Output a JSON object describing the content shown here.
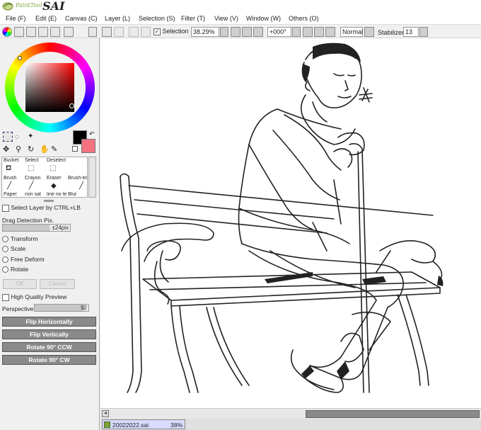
{
  "app": {
    "logo_small": "PaintTool",
    "logo_big": "SAI"
  },
  "menu": {
    "items": [
      {
        "label": "File (F)"
      },
      {
        "label": "Edit (E)"
      },
      {
        "label": "Canvas (C)"
      },
      {
        "label": "Layer (L)"
      },
      {
        "label": "Selection (S)"
      },
      {
        "label": "Filter (T)"
      },
      {
        "label": "View (V)"
      },
      {
        "label": "Window (W)"
      },
      {
        "label": "Others (O)"
      }
    ]
  },
  "toolbar": {
    "selection_label": "Selection",
    "selection_checked": true,
    "zoom": "38.29%",
    "rotation": "+000°",
    "blend_mode": "Normal",
    "stabilizer_label": "Stabilizer",
    "stabilizer_value": "13"
  },
  "colors": {
    "primary": "#000000",
    "secondary": "#f4717f",
    "accent": "#8a8a8a"
  },
  "tools": {
    "row1": [
      "Bucket",
      "Select",
      "Deselect",
      ""
    ],
    "row2": [
      "Brush",
      "Crayon",
      "Eraser",
      "Brush-lin"
    ],
    "row3": [
      "Paper",
      "non sat",
      "line no te",
      "Blur"
    ]
  },
  "options": {
    "select_layer_label": "Select Layer by CTRL+LB",
    "drag_detection_label": "Drag Detection Pix.",
    "drag_detection_value": "±24pix",
    "transform": "Transform",
    "scale": "Scale",
    "free_deform": "Free Deform",
    "rotate": "Rotate",
    "ok": "OK",
    "cancel": "Cancel",
    "hq_preview": "High Quality Preview",
    "perspective_label": "Perspective",
    "perspective_value": "92",
    "flip_h": "Flip Horizontally",
    "flip_v": "Flip Vertically",
    "rot_ccw": "Rotate 90° CCW",
    "rot_cw": "Rotate 90° CW"
  },
  "status": {
    "file_name": "20022022.sai",
    "zoom": "38%"
  }
}
